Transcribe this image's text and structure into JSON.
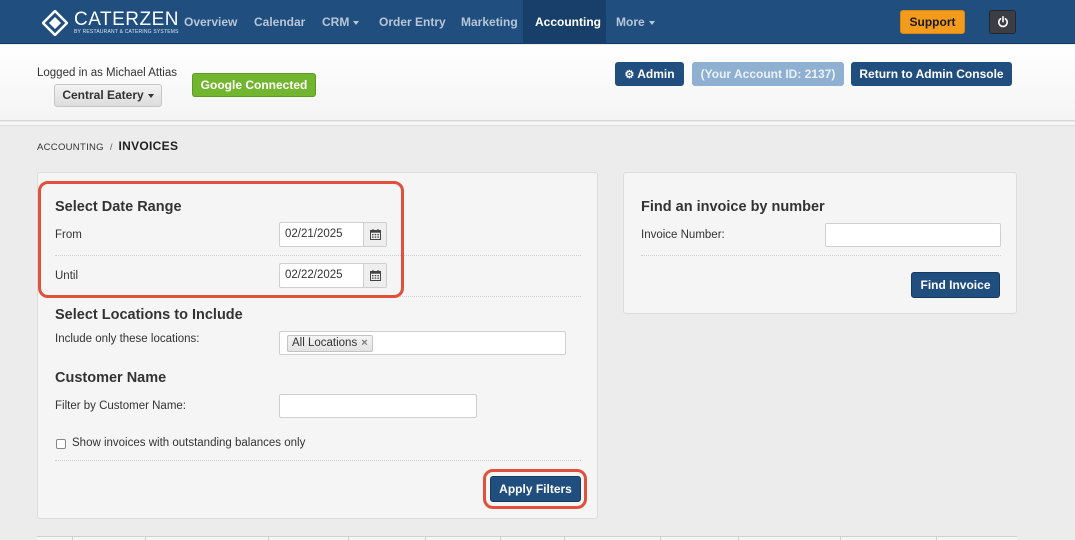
{
  "brand": {
    "name": "CATERZEN",
    "tagline": "by RESTAURANT & CATERING SYSTEMS"
  },
  "nav": {
    "items": [
      {
        "label": "Overview"
      },
      {
        "label": "Calendar"
      },
      {
        "label": "CRM"
      },
      {
        "label": "Order Entry"
      },
      {
        "label": "Marketing"
      },
      {
        "label": "Accounting"
      },
      {
        "label": "More"
      }
    ],
    "active": "Accounting",
    "support_label": "Support"
  },
  "header": {
    "logged_in_text": "Logged in as Michael Attias",
    "location_select": "Central Eatery",
    "google_label": "Google Connected",
    "admin_label": "Admin",
    "account_id_label": "(Your Account ID: 2137)",
    "return_label": "Return to Admin Console"
  },
  "breadcrumb": {
    "root": "ACCOUNTING",
    "separator": "/",
    "current": "INVOICES"
  },
  "filters": {
    "date_range_title": "Select Date Range",
    "from_label": "From",
    "from_value": "02/21/2025",
    "until_label": "Until",
    "until_value": "02/22/2025",
    "locations_title": "Select Locations to Include",
    "locations_label": "Include only these locations:",
    "locations_chip": "All Locations",
    "customer_title": "Customer Name",
    "customer_label": "Filter by Customer Name:",
    "customer_value": "",
    "outstanding_label": "Show invoices with outstanding balances only",
    "apply_label": "Apply Filters"
  },
  "find_invoice": {
    "title": "Find an invoice by number",
    "number_label": "Invoice Number:",
    "number_value": "",
    "button_label": "Find Invoice"
  },
  "colors": {
    "nav_bg": "#1f4e7f",
    "primary": "#1f4e7f",
    "support": "#f29b1d",
    "google": "#72b52e",
    "highlight": "#e0503a"
  }
}
